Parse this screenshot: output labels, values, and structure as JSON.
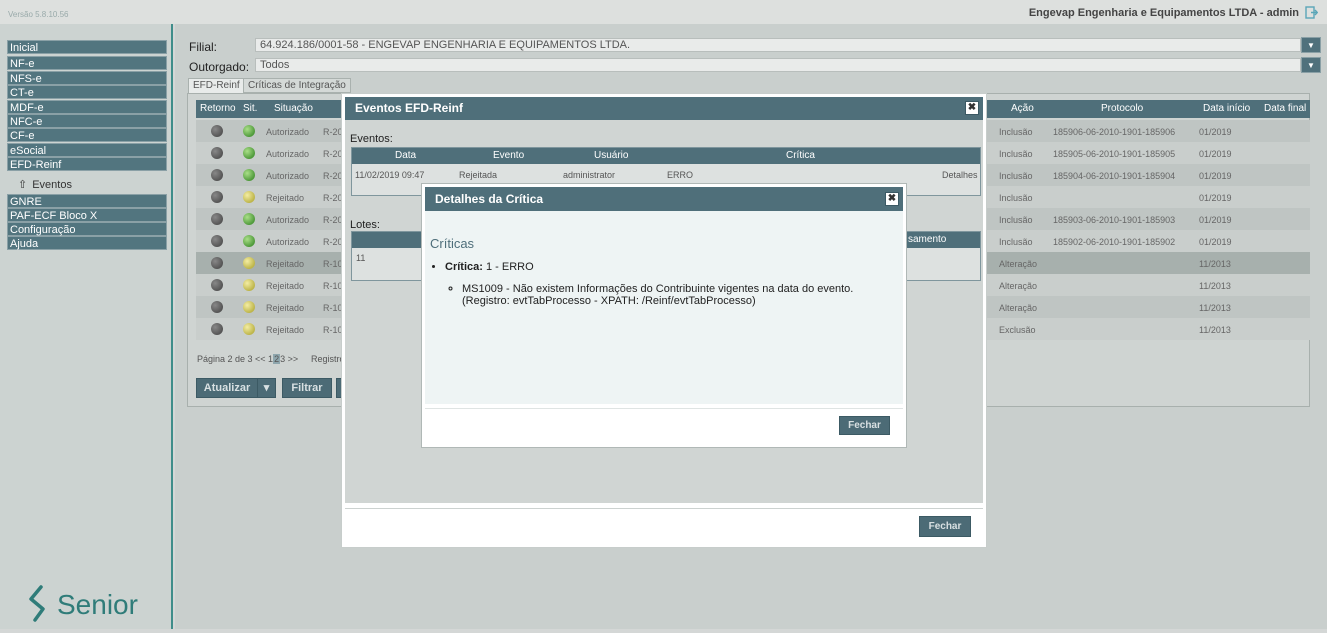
{
  "topbar": {
    "version": "Versão 5.8.10.56",
    "company": "Engevap Engenharia e Equipamentos LTDA - admin",
    "logout_icon": "logout-icon"
  },
  "sidebar": {
    "items": [
      {
        "label": "Inicial"
      },
      {
        "label": "NF-e"
      },
      {
        "label": "NFS-e"
      },
      {
        "label": "CT-e"
      },
      {
        "label": "MDF-e"
      },
      {
        "label": "NFC-e"
      },
      {
        "label": "CF-e"
      },
      {
        "label": "eSocial"
      },
      {
        "label": "EFD-Reinf"
      },
      {
        "label": "GNRE"
      },
      {
        "label": "PAF-ECF Bloco X"
      },
      {
        "label": "Configuração"
      },
      {
        "label": "Ajuda"
      }
    ],
    "submenu": {
      "label": "Eventos"
    },
    "logo_text": "Senior"
  },
  "filters": {
    "filial_label": "Filial:",
    "filial_value": "64.924.186/0001-58 - ENGEVAP ENGENHARIA E EQUIPAMENTOS LTDA.",
    "outorgado_label": "Outorgado:",
    "outorgado_value": "Todos"
  },
  "tabs": [
    {
      "label": "EFD-Reinf"
    },
    {
      "label": "Críticas de Integração"
    }
  ],
  "table": {
    "columns": [
      "Retorno",
      "Sit.",
      "Situação",
      "Ação",
      "Protocolo",
      "Data início",
      "Data final"
    ],
    "rows": [
      {
        "situacao": "Autorizado",
        "evento": "R-20",
        "acao": "Inclusão",
        "protocolo": "185906-06-2010-1901-185906",
        "inicio": "01/2019"
      },
      {
        "situacao": "Autorizado",
        "evento": "R-20",
        "acao": "Inclusão",
        "protocolo": "185905-06-2010-1901-185905",
        "inicio": "01/2019"
      },
      {
        "situacao": "Autorizado",
        "evento": "R-20",
        "acao": "Inclusão",
        "protocolo": "185904-06-2010-1901-185904",
        "inicio": "01/2019"
      },
      {
        "situacao": "Rejeitado",
        "evento": "R-20",
        "acao": "Inclusão",
        "protocolo": "",
        "inicio": "01/2019"
      },
      {
        "situacao": "Autorizado",
        "evento": "R-20",
        "acao": "Inclusão",
        "protocolo": "185903-06-2010-1901-185903",
        "inicio": "01/2019"
      },
      {
        "situacao": "Autorizado",
        "evento": "R-20",
        "acao": "Inclusão",
        "protocolo": "185902-06-2010-1901-185902",
        "inicio": "01/2019"
      },
      {
        "situacao": "Rejeitado",
        "evento": "R-10",
        "acao": "Alteração",
        "protocolo": "",
        "inicio": "11/2013"
      },
      {
        "situacao": "Rejeitado",
        "evento": "R-10",
        "acao": "Alteração",
        "protocolo": "",
        "inicio": "11/2013"
      },
      {
        "situacao": "Rejeitado",
        "evento": "R-10",
        "acao": "Alteração",
        "protocolo": "",
        "inicio": "11/2013"
      },
      {
        "situacao": "Rejeitado",
        "evento": "R-10",
        "acao": "Exclusão",
        "protocolo": "",
        "inicio": "11/2013"
      }
    ]
  },
  "pager": {
    "prefix": "Página 2 de 3 << 1",
    "current": "2",
    "suffix": "3 >>",
    "registros": "Registro"
  },
  "buttons": {
    "atualizar": "Atualizar",
    "filtrar": "Filtrar"
  },
  "modal_eventos": {
    "title": "Eventos EFD-Reinf",
    "eventos_label": "Eventos:",
    "columns": [
      "Data",
      "Evento",
      "Usuário",
      "Crítica"
    ],
    "row": {
      "data": "11/02/2019 09:47",
      "evento": "Rejeitada",
      "usuario": "administrator",
      "critica": "ERRO",
      "detalhes": "Detalhes"
    },
    "lotes_label": "Lotes:",
    "lotes_header_fragment": "samento",
    "lotes_row_value": "11",
    "close_label": "Fechar"
  },
  "modal_critica": {
    "title": "Detalhes da Crítica",
    "heading": "Críticas",
    "item_label": "Crítica:",
    "item_value": "1 - ERRO",
    "detail": "MS1009 - Não existem Informações do Contribuinte vigentes na data do evento. (Registro: evtTabProcesso - XPATH: /Reinf/evtTabProcesso)",
    "close_label": "Fechar"
  },
  "colors": {
    "header_bg": "#4f6f7a",
    "sidebar_item_bg": "#52757f",
    "accent": "#3f8d8a"
  }
}
